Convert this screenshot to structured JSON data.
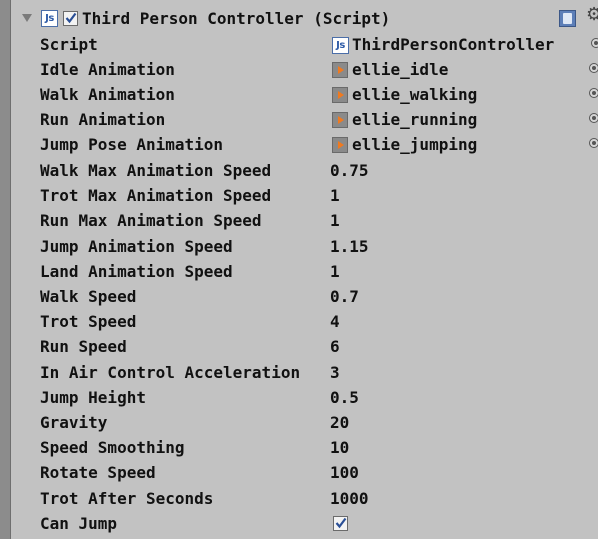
{
  "component": {
    "title": "Third Person Controller (Script)",
    "enabled": true,
    "script_label": "Script",
    "script_value": "ThirdPersonController"
  },
  "animations": [
    {
      "label": "Idle Animation",
      "value": "ellie_idle"
    },
    {
      "label": "Walk Animation",
      "value": "ellie_walking"
    },
    {
      "label": "Run Animation",
      "value": "ellie_running"
    },
    {
      "label": "Jump Pose Animation",
      "value": "ellie_jumping"
    }
  ],
  "fields": [
    {
      "label": "Walk Max Animation Speed",
      "value": "0.75"
    },
    {
      "label": "Trot Max Animation Speed",
      "value": "1"
    },
    {
      "label": "Run Max Animation Speed",
      "value": "1"
    },
    {
      "label": "Jump Animation Speed",
      "value": "1.15"
    },
    {
      "label": "Land Animation Speed",
      "value": "1"
    },
    {
      "label": "Walk Speed",
      "value": "0.7"
    },
    {
      "label": "Trot Speed",
      "value": "4"
    },
    {
      "label": "Run Speed",
      "value": "6"
    },
    {
      "label": "In Air Control Acceleration",
      "value": "3"
    },
    {
      "label": "Jump Height",
      "value": "0.5"
    },
    {
      "label": "Gravity",
      "value": "20"
    },
    {
      "label": "Speed Smoothing",
      "value": "10"
    },
    {
      "label": "Rotate Speed",
      "value": "100"
    },
    {
      "label": "Trot After Seconds",
      "value": "1000"
    }
  ],
  "can_jump": {
    "label": "Can Jump",
    "checked": true
  },
  "icons": {
    "foldout": "triangle-down-icon",
    "script": "js-script-icon",
    "help": "help-icon",
    "settings": "gear-icon",
    "animation": "animation-clip-icon",
    "picker": "object-picker-icon"
  },
  "colors": {
    "panel_bg": "#c2c2c2",
    "text": "#111111",
    "js_icon": "#2d5aa6",
    "anim_play": "#f07a1f"
  }
}
